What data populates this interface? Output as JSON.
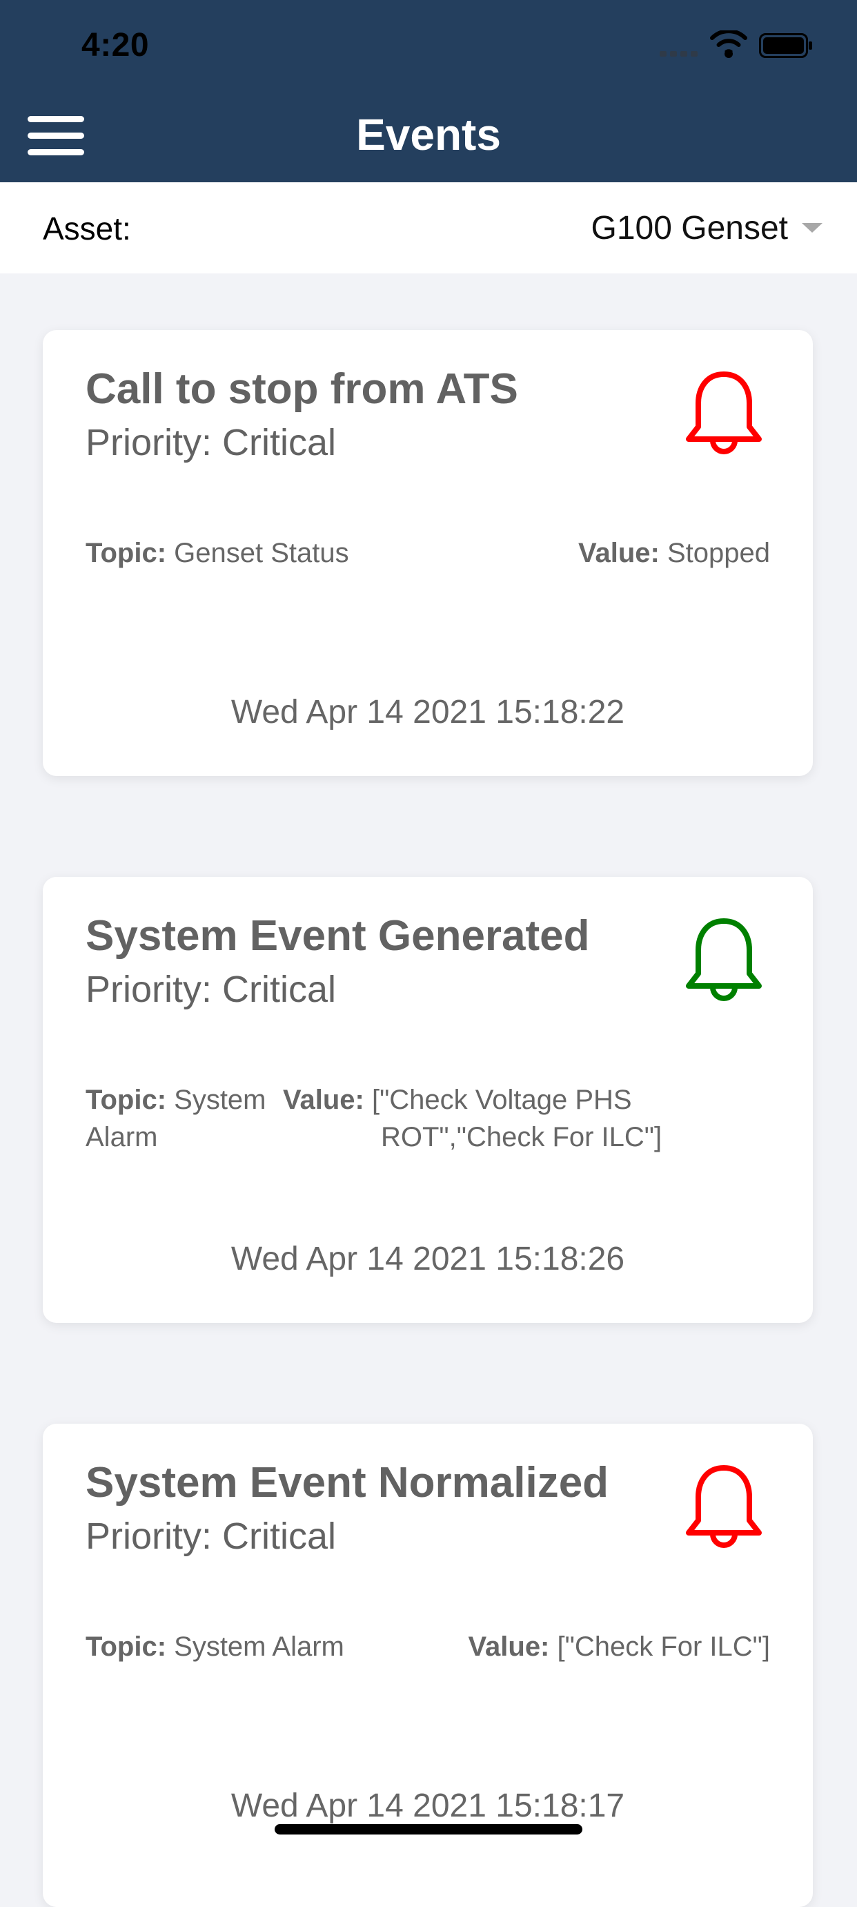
{
  "status_bar": {
    "time": "4:20"
  },
  "header": {
    "title": "Events",
    "menu_icon": "hamburger-menu-icon"
  },
  "asset_selector": {
    "label": "Asset:",
    "selected": "G100 Genset",
    "dropdown_icon": "caret-down-icon"
  },
  "colors": {
    "header_bg": "#243f5e",
    "page_bg": "#f2f3f7",
    "bell_active": "#ff0000",
    "bell_normal": "#008000"
  },
  "events": [
    {
      "title": "Call to stop from ATS",
      "priority": "Priority: Critical",
      "topic_label": "Topic:",
      "topic": "Genset Status",
      "value_label": "Value:",
      "value": "Stopped",
      "timestamp": "Wed Apr 14 2021 15:18:22",
      "bell_color": "#ff0000",
      "icon": "bell-icon"
    },
    {
      "title": "System Event Generated",
      "priority": "Priority: Critical",
      "topic_label": "Topic:",
      "topic": "System Alarm",
      "value_label": "Value:",
      "value": "[\"Check Voltage PHS ROT\",\"Check For ILC\"]",
      "timestamp": "Wed Apr 14 2021 15:18:26",
      "bell_color": "#008000",
      "icon": "bell-icon"
    },
    {
      "title": "System Event Normalized",
      "priority": "Priority: Critical",
      "topic_label": "Topic:",
      "topic": "System Alarm",
      "value_label": "Value:",
      "value": "[\"Check For ILC\"]",
      "timestamp": "Wed Apr 14 2021 15:18:17",
      "bell_color": "#ff0000",
      "icon": "bell-icon"
    }
  ]
}
